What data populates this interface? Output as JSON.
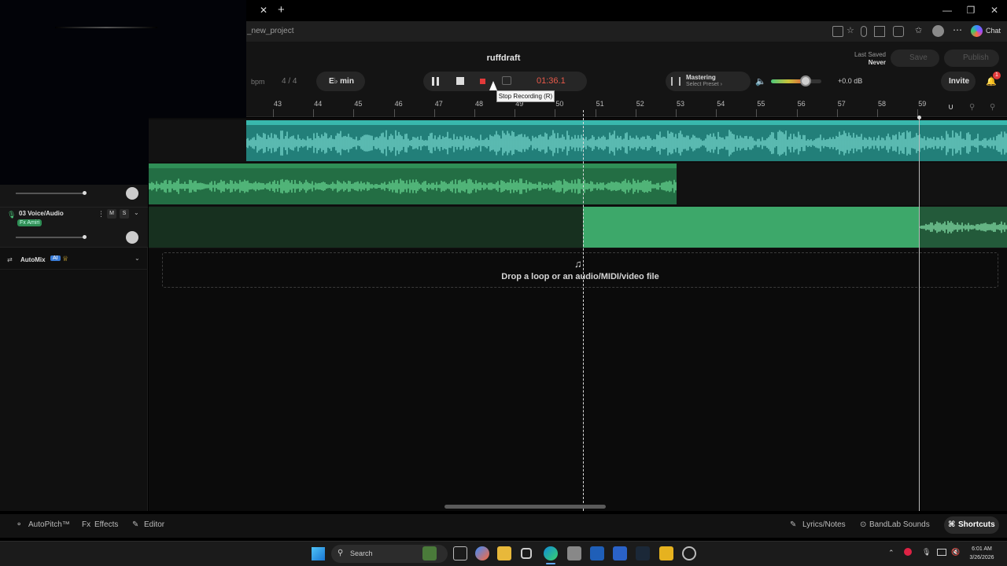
{
  "browser": {
    "url": "_new_project",
    "chat_label": "Chat"
  },
  "header": {
    "song_title": "ruffdraft",
    "bpm_label": "bpm",
    "time_signature": "4 / 4",
    "key_label": "E♭ min",
    "time_display": "01:36.1",
    "mastering_title": "Mastering",
    "mastering_preset": "Select Preset ›",
    "volume_db": "+0.0 dB",
    "volume_level": 0.68,
    "last_saved_label": "Last Saved",
    "last_saved_value": "Never",
    "save_label": "Save",
    "publish_label": "Publish",
    "invite_label": "Invite",
    "notification_count": "1"
  },
  "tooltip": "Stop Recording (R)",
  "ruler": {
    "bars": [
      "43",
      "44",
      "45",
      "46",
      "47",
      "48",
      "49",
      "50",
      "51",
      "52",
      "53",
      "54",
      "55",
      "56",
      "57",
      "58",
      "59"
    ]
  },
  "tracks": [
    {
      "name": "03 Voice/Audio",
      "fx": "Fx Amiri",
      "mute": "M",
      "solo": "S"
    }
  ],
  "automix": {
    "label": "AutoMix",
    "badge": "AI"
  },
  "dropzone": "Drop a loop or an audio/MIDI/video file",
  "bottom_tools": {
    "autopitch": "AutoPitch™",
    "effects": "Effects",
    "editor": "Editor",
    "lyrics": "Lyrics/Notes",
    "sounds": "BandLab Sounds",
    "shortcuts": "Shortcuts"
  },
  "taskbar": {
    "search": "Search",
    "time": "6:01 AM",
    "date": "3/26/2026"
  },
  "colors": {
    "teal_clip": "#2a9d94",
    "green_clip": "#2f8f56",
    "recording_clip": "#3da86a",
    "record_red": "#e23a3a",
    "accent_green": "#4cc77a"
  }
}
